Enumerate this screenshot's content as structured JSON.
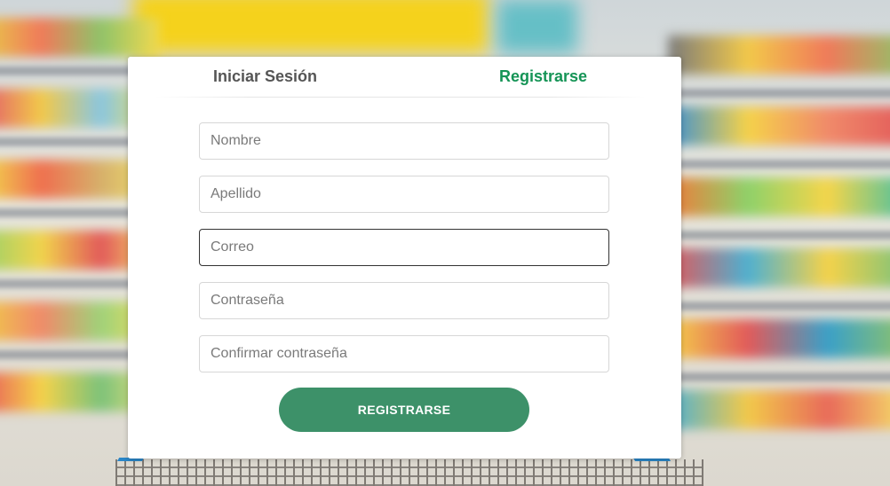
{
  "tabs": {
    "login_label": "Iniciar Sesión",
    "register_label": "Registrarse",
    "active": "register"
  },
  "form": {
    "fields": [
      {
        "placeholder": "Nombre",
        "value": ""
      },
      {
        "placeholder": "Apellido",
        "value": ""
      },
      {
        "placeholder": "Correo",
        "value": ""
      },
      {
        "placeholder": "Contraseña",
        "value": ""
      },
      {
        "placeholder": "Confirmar contraseña",
        "value": ""
      }
    ],
    "submit_label": "REGISTRARSE"
  },
  "colors": {
    "active_tab": "#159456",
    "inactive_tab": "#555555",
    "button_bg": "#3d9169",
    "button_text": "#ffffff"
  }
}
